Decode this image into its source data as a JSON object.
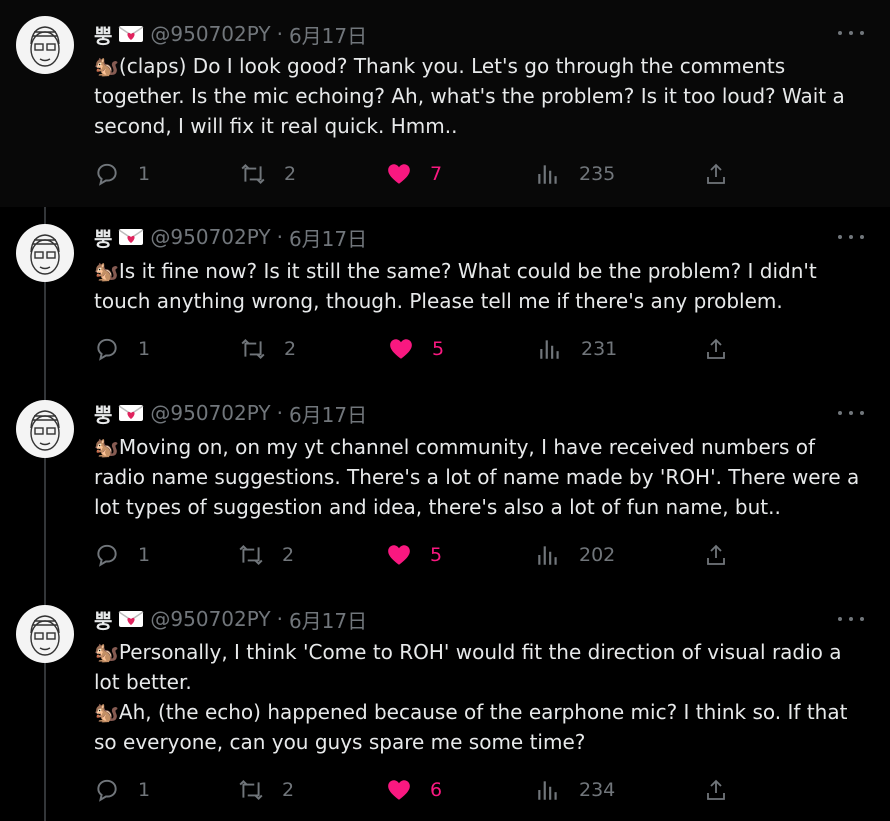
{
  "tweets": [
    {
      "name": "뿡",
      "handle": "@950702PY",
      "separator": "·",
      "date": "6月17日",
      "lines": [
        "🐿️(claps) Do I look good? Thank you. Let's go through the comments",
        "together. Is the mic echoing? Ah, what's the problem? Is it too loud? Wait a",
        "second, I will fix it real quick. Hmm.."
      ],
      "replies": "1",
      "retweets": "2",
      "likes": "7",
      "views": "235"
    },
    {
      "name": "뿡",
      "handle": "@950702PY",
      "separator": "·",
      "date": "6月17日",
      "lines": [
        "🐿️Is it fine now? Is it still the same? What could be the problem? I didn't",
        "touch anything wrong, though. Please tell me if there's any problem."
      ],
      "replies": "1",
      "retweets": "2",
      "likes": "5",
      "views": "231"
    },
    {
      "name": "뿡",
      "handle": "@950702PY",
      "separator": "·",
      "date": "6月17日",
      "lines": [
        "🐿️Moving on, on my yt channel community, I have received numbers of",
        "radio name suggestions. There's a lot of name made by 'ROH'. There were a",
        "lot types of suggestion and idea, there's also a lot of fun name, but.."
      ],
      "replies": "1",
      "retweets": "2",
      "likes": "5",
      "views": "202"
    },
    {
      "name": "뿡",
      "handle": "@950702PY",
      "separator": "·",
      "date": "6月17日",
      "lines": [
        "🐿️Personally, I think 'Come to ROH' would fit the direction of visual radio a",
        "lot better.",
        "🐿️Ah, (the echo) happened because of the earphone mic? I think so. If that",
        "so everyone, can you guys spare me some time?"
      ],
      "replies": "1",
      "retweets": "2",
      "likes": "6",
      "views": "234"
    }
  ],
  "icons": {
    "reply": "reply-icon",
    "retweet": "retweet-icon",
    "like": "heart-icon",
    "views": "views-icon",
    "share": "share-icon",
    "more": "more-icon",
    "badge": "love-letter-icon"
  },
  "colors": {
    "background": "#000000",
    "text": "#e7e9ea",
    "muted": "#71767b",
    "like": "#f91880"
  }
}
